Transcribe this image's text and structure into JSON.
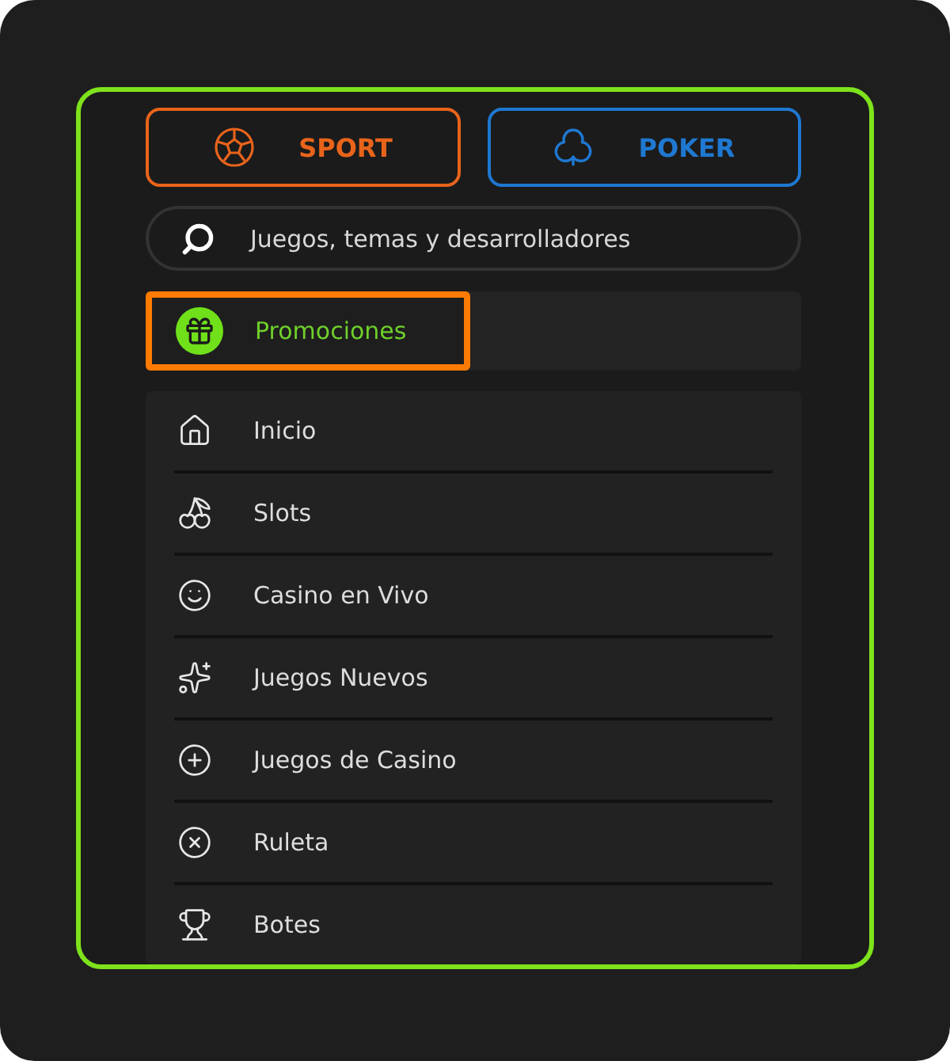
{
  "top_buttons": [
    {
      "label": "SPORT",
      "color": "#e8641b"
    },
    {
      "label": "POKER",
      "color": "#1f78d1"
    }
  ],
  "search": {
    "placeholder": "Juegos, temas y desarrolladores"
  },
  "promo": {
    "label": "Promociones",
    "highlighted": true
  },
  "menu": [
    {
      "label": "Inicio"
    },
    {
      "label": "Slots"
    },
    {
      "label": "Casino en Vivo"
    },
    {
      "label": "Juegos Nuevos"
    },
    {
      "label": "Juegos de Casino"
    },
    {
      "label": "Ruleta"
    },
    {
      "label": "Botes"
    }
  ]
}
